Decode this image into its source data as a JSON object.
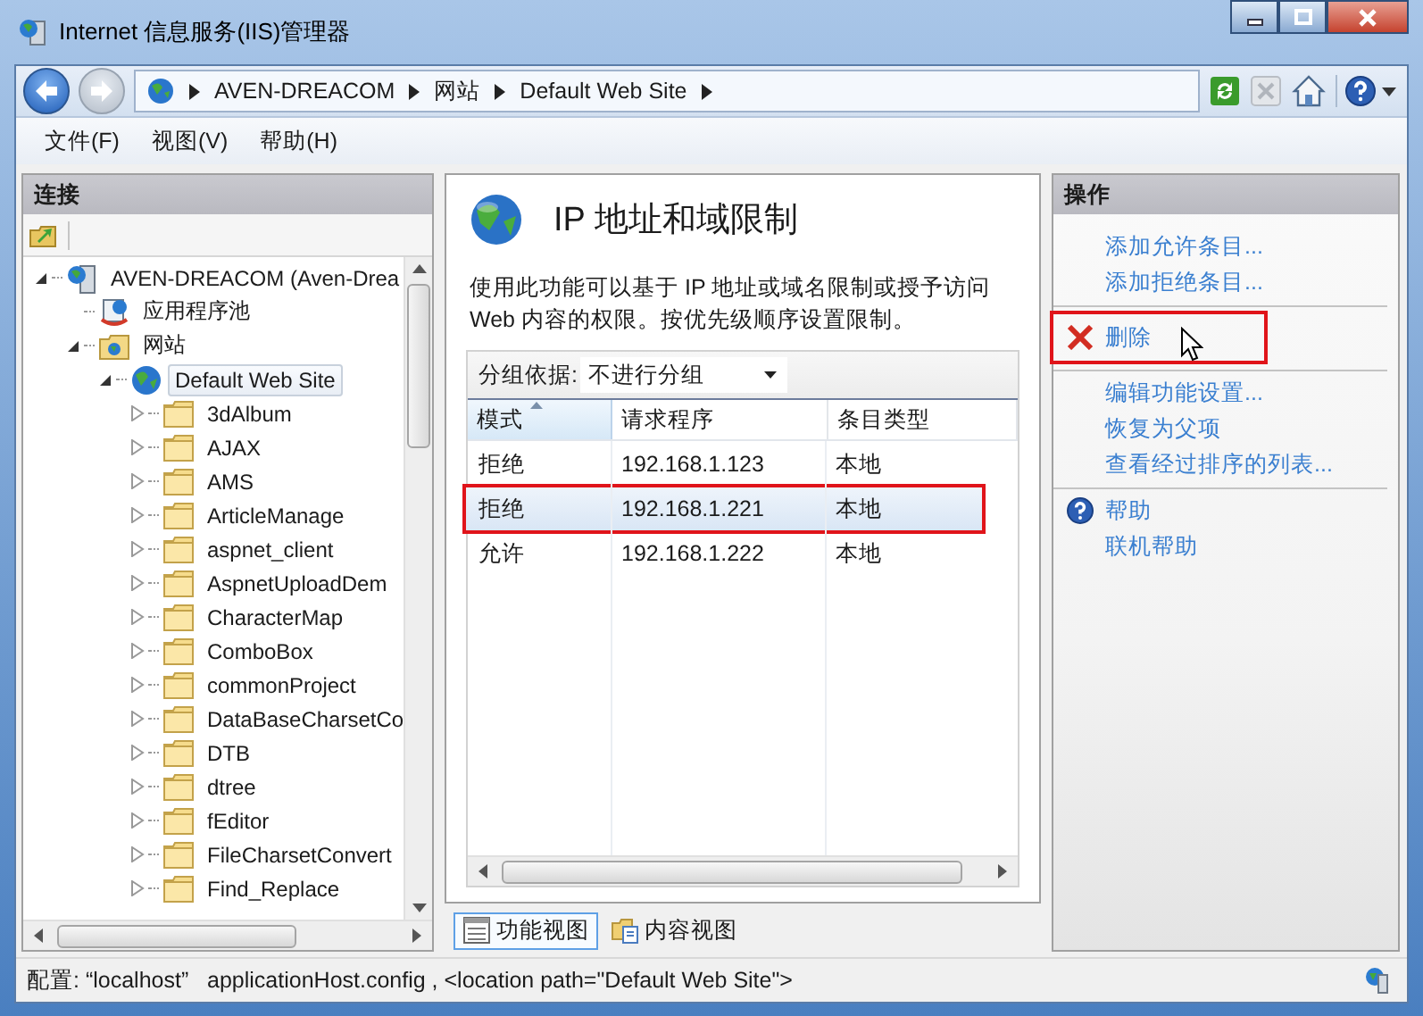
{
  "window": {
    "title": "Internet 信息服务(IIS)管理器"
  },
  "address": {
    "crumbs": [
      "AVEN-DREACOM",
      "网站",
      "Default Web Site"
    ]
  },
  "menu": [
    "文件(F)",
    "视图(V)",
    "帮助(H)"
  ],
  "connections": {
    "title": "连接",
    "tree": [
      {
        "label": "AVEN-DREACOM (Aven-Drea",
        "kind": "server",
        "expanded": true,
        "selected": false,
        "children": [
          {
            "label": "应用程序池",
            "kind": "pool",
            "selected": false
          },
          {
            "label": "网站",
            "kind": "sites",
            "expanded": true,
            "selected": false,
            "children": [
              {
                "label": "Default Web Site",
                "kind": "site",
                "expanded": true,
                "selected": true,
                "children": [
                  {
                    "label": "3dAlbum",
                    "kind": "folder",
                    "expanded": false,
                    "selected": false
                  },
                  {
                    "label": "AJAX",
                    "kind": "folder",
                    "expanded": false,
                    "selected": false
                  },
                  {
                    "label": "AMS",
                    "kind": "folder",
                    "expanded": false,
                    "selected": false
                  },
                  {
                    "label": "ArticleManage",
                    "kind": "folder",
                    "expanded": false,
                    "selected": false
                  },
                  {
                    "label": "aspnet_client",
                    "kind": "folder",
                    "expanded": false,
                    "selected": false
                  },
                  {
                    "label": "AspnetUploadDem",
                    "kind": "folder",
                    "expanded": false,
                    "selected": false
                  },
                  {
                    "label": "CharacterMap",
                    "kind": "folder",
                    "expanded": false,
                    "selected": false
                  },
                  {
                    "label": "ComboBox",
                    "kind": "folder",
                    "expanded": false,
                    "selected": false
                  },
                  {
                    "label": "commonProject",
                    "kind": "folder",
                    "expanded": false,
                    "selected": false
                  },
                  {
                    "label": "DataBaseCharsetCo",
                    "kind": "folder",
                    "expanded": false,
                    "selected": false
                  },
                  {
                    "label": "DTB",
                    "kind": "folder",
                    "expanded": false,
                    "selected": false
                  },
                  {
                    "label": "dtree",
                    "kind": "folder",
                    "expanded": false,
                    "selected": false
                  },
                  {
                    "label": "fEditor",
                    "kind": "folder",
                    "expanded": false,
                    "selected": false
                  },
                  {
                    "label": "FileCharsetConvert",
                    "kind": "folder",
                    "expanded": false,
                    "selected": false
                  },
                  {
                    "label": "Find_Replace",
                    "kind": "folder",
                    "expanded": false,
                    "selected": false
                  }
                ]
              }
            ]
          }
        ]
      }
    ]
  },
  "feature": {
    "title": "IP 地址和域限制",
    "description": "使用此功能可以基于 IP 地址或域名限制或授予访问 Web 内容的权限。按优先级顺序设置限制。",
    "group_label": "分组依据:",
    "group_value": "不进行分组",
    "columns": [
      {
        "label": "模式",
        "sorted": true
      },
      {
        "label": "请求程序",
        "sorted": false
      },
      {
        "label": "条目类型",
        "sorted": false
      }
    ],
    "rows": [
      {
        "cells": [
          "拒绝",
          "192.168.1.123",
          "本地"
        ],
        "selected": false,
        "highlighted": false
      },
      {
        "cells": [
          "拒绝",
          "192.168.1.221",
          "本地"
        ],
        "selected": true,
        "highlighted": true
      },
      {
        "cells": [
          "允许",
          "192.168.1.222",
          "本地"
        ],
        "selected": false,
        "highlighted": false
      }
    ],
    "views": [
      {
        "label": "功能视图",
        "kind": "features",
        "selected": true
      },
      {
        "label": "内容视图",
        "kind": "content",
        "selected": false
      }
    ]
  },
  "actions": {
    "title": "操作",
    "groups": [
      [
        {
          "label": "添加允许条目...",
          "kind": "link",
          "highlighted": false,
          "hovered": false
        },
        {
          "label": "添加拒绝条目...",
          "kind": "link",
          "highlighted": false,
          "hovered": false
        }
      ],
      [
        {
          "label": "删除",
          "kind": "delete",
          "highlighted": true,
          "hovered": true
        }
      ],
      [
        {
          "label": "编辑功能设置...",
          "kind": "link",
          "highlighted": false,
          "hovered": false
        },
        {
          "label": "恢复为父项",
          "kind": "link",
          "highlighted": false,
          "hovered": false
        },
        {
          "label": "查看经过排序的列表...",
          "kind": "link",
          "highlighted": false,
          "hovered": false
        }
      ],
      [
        {
          "label": "帮助",
          "kind": "help",
          "highlighted": false,
          "hovered": false
        },
        {
          "label": "联机帮助",
          "kind": "link",
          "highlighted": false,
          "hovered": false
        }
      ]
    ]
  },
  "status_bar": "配置: “localhost”   applicationHost.config , <location path=\"Default Web Site\">"
}
